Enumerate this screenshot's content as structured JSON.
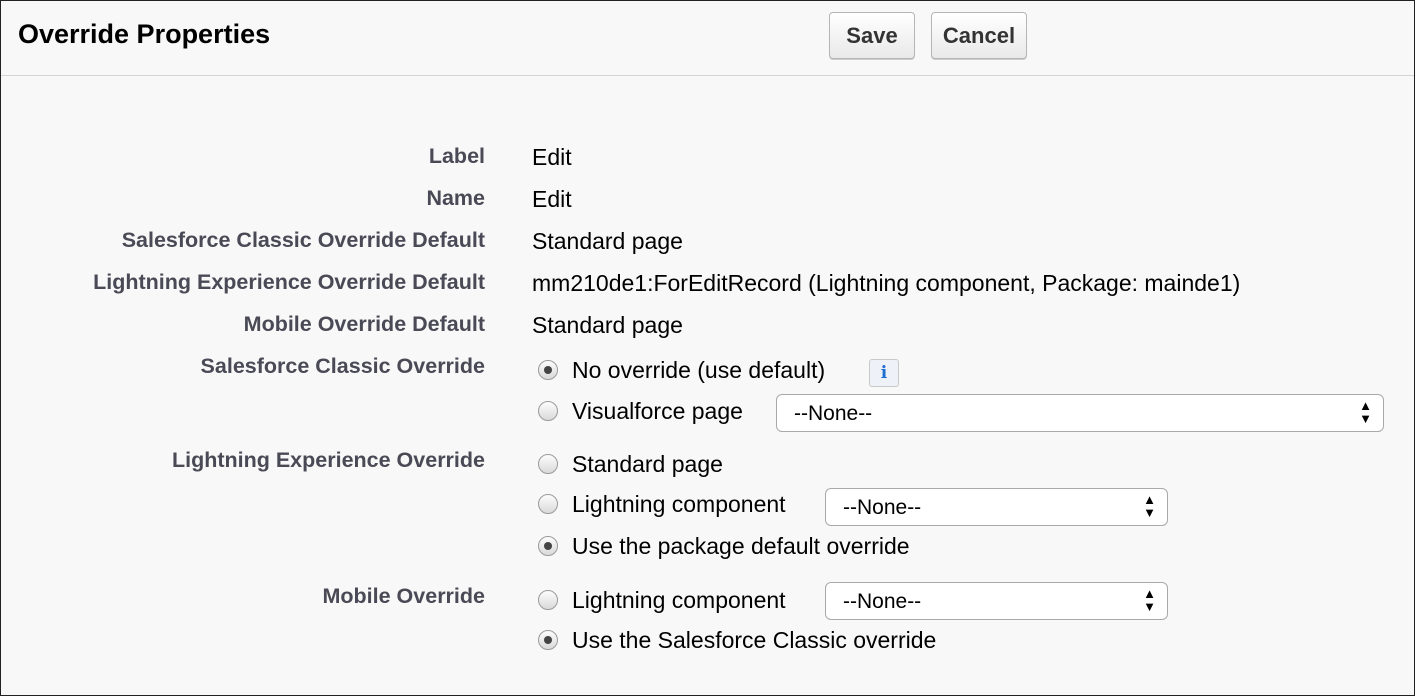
{
  "header": {
    "title": "Override Properties",
    "save_label": "Save",
    "cancel_label": "Cancel"
  },
  "fields": {
    "label": {
      "name": "Label",
      "value": "Edit"
    },
    "name": {
      "name": "Name",
      "value": "Edit"
    },
    "classic_default": {
      "name": "Salesforce Classic Override Default",
      "value": "Standard page"
    },
    "lightning_default": {
      "name": "Lightning Experience Override Default",
      "value": "mm210de1:ForEditRecord (Lightning component, Package: mainde1)"
    },
    "mobile_default": {
      "name": "Mobile Override Default",
      "value": "Standard page"
    }
  },
  "classic_override": {
    "label": "Salesforce Classic Override",
    "options": [
      {
        "label": "No override (use default)",
        "checked": true
      },
      {
        "label": "Visualforce page",
        "checked": false
      }
    ],
    "info_icon": "info-icon",
    "visualforce_select": "--None--"
  },
  "lightning_override": {
    "label": "Lightning Experience Override",
    "options": [
      {
        "label": "Standard page",
        "checked": false
      },
      {
        "label": "Lightning component",
        "checked": false
      },
      {
        "label": "Use the package default override",
        "checked": true
      }
    ],
    "component_select": "--None--"
  },
  "mobile_override": {
    "label": "Mobile Override",
    "options": [
      {
        "label": "Lightning component",
        "checked": false
      },
      {
        "label": "Use the Salesforce Classic override",
        "checked": true
      }
    ],
    "component_select": "--None--"
  }
}
